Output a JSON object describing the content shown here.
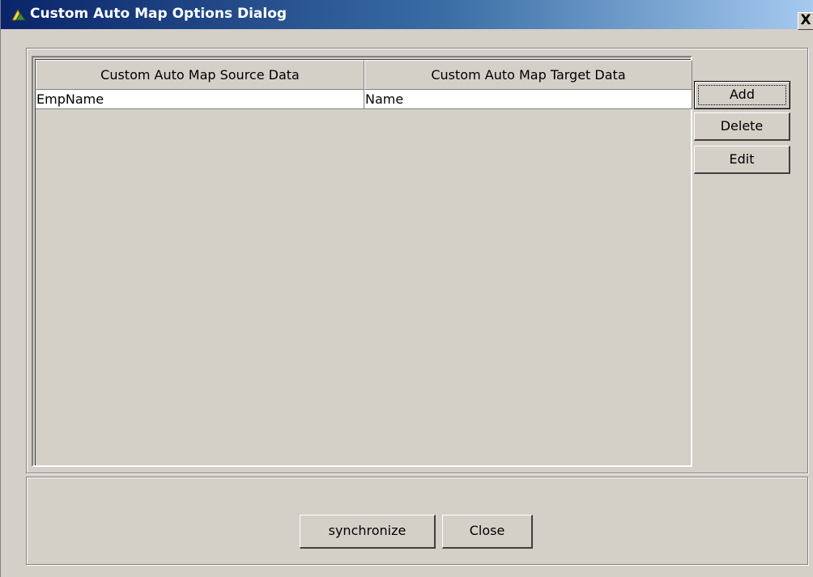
{
  "window": {
    "title": "Custom Auto Map Options Dialog",
    "close_glyph": "X",
    "icon": "app-icon"
  },
  "table": {
    "columns": [
      "Custom Auto Map Source Data",
      "Custom Auto Map Target Data"
    ],
    "rows": [
      [
        "EmpName",
        "Name"
      ]
    ]
  },
  "side_buttons": {
    "add": "Add",
    "delete": "Delete",
    "edit": "Edit"
  },
  "bottom_buttons": {
    "synchronize": "synchronize",
    "close": "Close"
  },
  "colors": {
    "face": "#d4d0c8",
    "title_start": "#0a246a",
    "title_end": "#a6caf0"
  }
}
